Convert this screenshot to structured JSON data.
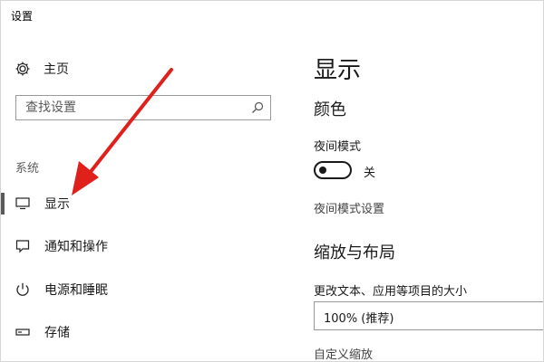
{
  "window": {
    "title": "设置"
  },
  "sidebar": {
    "home": {
      "label": "主页",
      "icon": "gear-icon"
    },
    "search": {
      "placeholder": "查找设置",
      "icon": "search-icon"
    },
    "group_label": "系统",
    "items": [
      {
        "label": "显示",
        "icon": "monitor-icon",
        "active": true
      },
      {
        "label": "通知和操作",
        "icon": "notification-icon",
        "active": false
      },
      {
        "label": "电源和睡眠",
        "icon": "power-icon",
        "active": false
      },
      {
        "label": "存储",
        "icon": "storage-icon",
        "active": false
      }
    ]
  },
  "main": {
    "title": "显示",
    "color_section": {
      "heading": "颜色",
      "night_mode_label": "夜间模式",
      "toggle_state": "关",
      "night_mode_settings_link": "夜间模式设置"
    },
    "scale_section": {
      "heading": "缩放与布局",
      "size_label": "更改文本、应用等项目的大小",
      "selected_scale": "100% (推荐)",
      "custom_scale_link": "自定义缩放"
    }
  },
  "annotation": {
    "arrow_color": "#e0201b"
  },
  "colors": {
    "accent_bar": "#5a5a5a",
    "background": "#ffffff"
  }
}
